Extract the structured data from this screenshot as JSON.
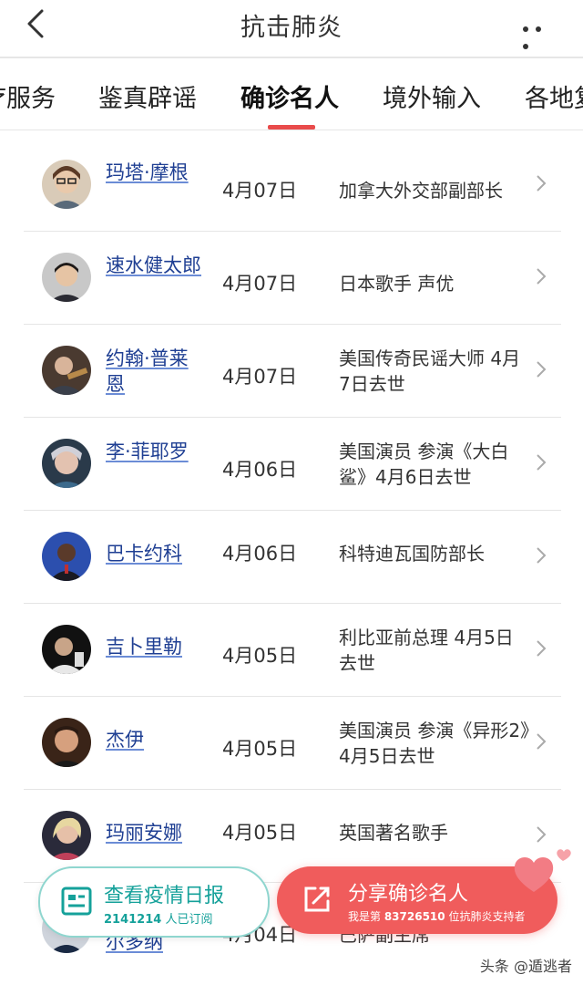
{
  "header": {
    "title": "抗击肺炎"
  },
  "tabs": [
    {
      "label": "疗服务",
      "active": false
    },
    {
      "label": "鉴真辟谣",
      "active": false
    },
    {
      "label": "确诊名人",
      "active": true
    },
    {
      "label": "境外输入",
      "active": false
    },
    {
      "label": "各地复",
      "active": false
    }
  ],
  "rows": [
    {
      "name": "玛塔·摩根",
      "date": "4月07日",
      "desc": "加拿大外交部副部长"
    },
    {
      "name": "速水健太郎",
      "date": "4月07日",
      "desc": "日本歌手 声优"
    },
    {
      "name": "约翰·普莱恩",
      "date": "4月07日",
      "desc": "美国传奇民谣大师 4月7日去世"
    },
    {
      "name": "李·菲耶罗",
      "date": "4月06日",
      "desc": "美国演员 参演《大白鲨》4月6日去世"
    },
    {
      "name": "巴卡约科",
      "date": "4月06日",
      "desc": "科特迪瓦国防部长"
    },
    {
      "name": "吉卜里勒",
      "date": "4月05日",
      "desc": "利比亚前总理 4月5日去世"
    },
    {
      "name": "杰伊",
      "date": "4月05日",
      "desc": "美国演员 参演《异形2》4月5日去世"
    },
    {
      "name": "玛丽安娜",
      "date": "4月05日",
      "desc": "英国著名歌手"
    },
    {
      "name": "尔多纳",
      "date": "4月04日",
      "desc": "巴萨副主席"
    }
  ],
  "report_button": {
    "label": "查看疫情日报",
    "count": "2141214",
    "sub": " 人已订阅"
  },
  "share_button": {
    "label": "分享确诊名人",
    "sub_prefix": "我是第 ",
    "count": "83726510",
    "sub_suffix": " 位抗肺炎支持者"
  },
  "watermark": "头条 @遁逃者",
  "colors": {
    "accent": "#e94b4b",
    "link": "#1f3f93",
    "teal": "#15a19a",
    "share_bg": "#f05c5c"
  }
}
